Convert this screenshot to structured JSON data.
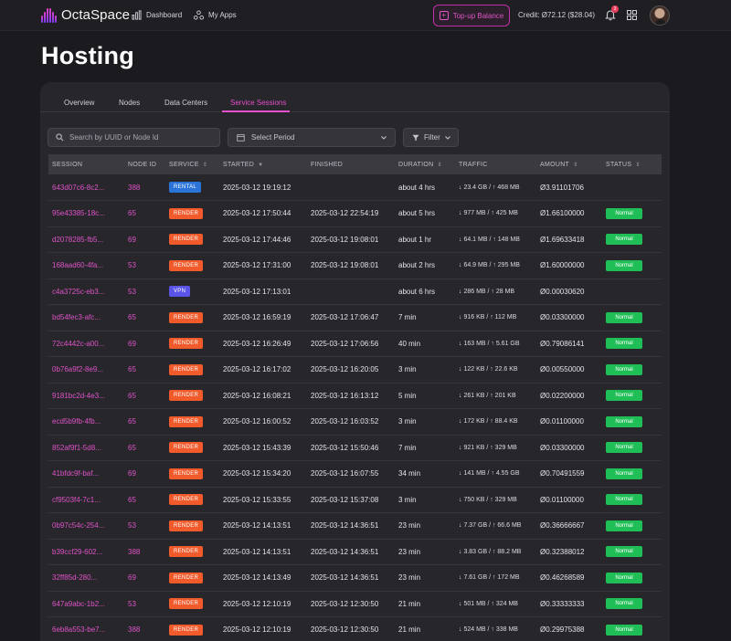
{
  "brand": {
    "name": "OctaSpace"
  },
  "nav": {
    "dashboard": "Dashboard",
    "apps": "My Apps"
  },
  "header": {
    "topup_label": "Top-up Balance",
    "credit": "Credit: Ø72.12 ($28.04)",
    "notifications_count": "3"
  },
  "page": {
    "title": "Hosting"
  },
  "tabs": [
    "Overview",
    "Nodes",
    "Data Centers",
    "Service Sessions"
  ],
  "active_tab": "Service Sessions",
  "filters": {
    "search_placeholder": "Search by UUID or Node Id",
    "period_label": "Select Period",
    "filter_label": "Filter"
  },
  "table": {
    "columns": [
      "SESSION",
      "NODE ID",
      "SERVICE",
      "STARTED",
      "FINISHED",
      "DURATION",
      "TRAFFIC",
      "AMOUNT",
      "STATUS"
    ],
    "rows": [
      {
        "session": "643d07c6-8c2...",
        "node": "388",
        "service": "RENTAL",
        "started": "2025-03-12 19:19:12",
        "finished": "",
        "duration": "about 4 hrs",
        "traffic": "↓ 23.4 GB / ↑ 468 MB",
        "amount": "Ø3.91101706",
        "status": ""
      },
      {
        "session": "95e43385-18c...",
        "node": "65",
        "service": "RENDER",
        "started": "2025-03-12 17:50:44",
        "finished": "2025-03-12 22:54:19",
        "duration": "about 5 hrs",
        "traffic": "↓ 977 MB / ↑ 425 MB",
        "amount": "Ø1.66100000",
        "status": "Normal"
      },
      {
        "session": "d2078285-fb5...",
        "node": "69",
        "service": "RENDER",
        "started": "2025-03-12 17:44:46",
        "finished": "2025-03-12 19:08:01",
        "duration": "about 1 hr",
        "traffic": "↓ 64.1 MB / ↑ 148 MB",
        "amount": "Ø1.69633418",
        "status": "Normal"
      },
      {
        "session": "168aad60-4fa...",
        "node": "53",
        "service": "RENDER",
        "started": "2025-03-12 17:31:00",
        "finished": "2025-03-12 19:08:01",
        "duration": "about 2 hrs",
        "traffic": "↓ 64.9 MB / ↑ 295 MB",
        "amount": "Ø1.60000000",
        "status": "Normal"
      },
      {
        "session": "c4a3725c-eb3...",
        "node": "53",
        "service": "VPN",
        "started": "2025-03-12 17:13:01",
        "finished": "",
        "duration": "about 6 hrs",
        "traffic": "↓ 286 MB / ↑ 28 MB",
        "amount": "Ø0.00030620",
        "status": ""
      },
      {
        "session": "bd54fec3-afc...",
        "node": "65",
        "service": "RENDER",
        "started": "2025-03-12 16:59:19",
        "finished": "2025-03-12 17:06:47",
        "duration": "7 min",
        "traffic": "↓ 916 KB / ↑ 112 MB",
        "amount": "Ø0.03300000",
        "status": "Normal"
      },
      {
        "session": "72c4442c-a00...",
        "node": "69",
        "service": "RENDER",
        "started": "2025-03-12 16:26:49",
        "finished": "2025-03-12 17:06:56",
        "duration": "40 min",
        "traffic": "↓ 163 MB / ↑ 5.61 GB",
        "amount": "Ø0.79086141",
        "status": "Normal"
      },
      {
        "session": "0b76a9f2-8e9...",
        "node": "65",
        "service": "RENDER",
        "started": "2025-03-12 16:17:02",
        "finished": "2025-03-12 16:20:05",
        "duration": "3 min",
        "traffic": "↓ 122 KB / ↑ 22.6 KB",
        "amount": "Ø0.00550000",
        "status": "Normal"
      },
      {
        "session": "9181bc2d-4e3...",
        "node": "65",
        "service": "RENDER",
        "started": "2025-03-12 16:08:21",
        "finished": "2025-03-12 16:13:12",
        "duration": "5 min",
        "traffic": "↓ 261 KB / ↑ 201 KB",
        "amount": "Ø0.02200000",
        "status": "Normal"
      },
      {
        "session": "ecd5b9fb-4fb...",
        "node": "65",
        "service": "RENDER",
        "started": "2025-03-12 16:00:52",
        "finished": "2025-03-12 16:03:52",
        "duration": "3 min",
        "traffic": "↓ 172 KB / ↑ 88.4 KB",
        "amount": "Ø0.01100000",
        "status": "Normal"
      },
      {
        "session": "852af9f1-5d8...",
        "node": "65",
        "service": "RENDER",
        "started": "2025-03-12 15:43:39",
        "finished": "2025-03-12 15:50:46",
        "duration": "7 min",
        "traffic": "↓ 921 KB / ↑ 329 MB",
        "amount": "Ø0.03300000",
        "status": "Normal"
      },
      {
        "session": "41bfdc9f-baf...",
        "node": "69",
        "service": "RENDER",
        "started": "2025-03-12 15:34:20",
        "finished": "2025-03-12 16:07:55",
        "duration": "34 min",
        "traffic": "↓ 141 MB / ↑ 4.55 GB",
        "amount": "Ø0.70491559",
        "status": "Normal"
      },
      {
        "session": "cf9503f4-7c1...",
        "node": "65",
        "service": "RENDER",
        "started": "2025-03-12 15:33:55",
        "finished": "2025-03-12 15:37:08",
        "duration": "3 min",
        "traffic": "↓ 750 KB / ↑ 329 MB",
        "amount": "Ø0.01100000",
        "status": "Normal"
      },
      {
        "session": "0b97c54c-254...",
        "node": "53",
        "service": "RENDER",
        "started": "2025-03-12 14:13:51",
        "finished": "2025-03-12 14:36:51",
        "duration": "23 min",
        "traffic": "↓ 7.37 GB / ↑ 66.6 MB",
        "amount": "Ø0.36666667",
        "status": "Normal"
      },
      {
        "session": "b39ccf29-602...",
        "node": "388",
        "service": "RENDER",
        "started": "2025-03-12 14:13:51",
        "finished": "2025-03-12 14:36:51",
        "duration": "23 min",
        "traffic": "↓ 3.83 GB / ↑ 88.2 MB",
        "amount": "Ø0.32388012",
        "status": "Normal"
      },
      {
        "session": "32ff85d-280...",
        "node": "69",
        "service": "RENDER",
        "started": "2025-03-12 14:13:49",
        "finished": "2025-03-12 14:36:51",
        "duration": "23 min",
        "traffic": "↓ 7.61 GB / ↑ 172 MB",
        "amount": "Ø0.46268589",
        "status": "Normal"
      },
      {
        "session": "647a9abc-1b2...",
        "node": "53",
        "service": "RENDER",
        "started": "2025-03-12 12:10:19",
        "finished": "2025-03-12 12:30:50",
        "duration": "21 min",
        "traffic": "↓ 501 MB / ↑ 324 MB",
        "amount": "Ø0.33333333",
        "status": "Normal"
      },
      {
        "session": "6eb8a553-be7...",
        "node": "388",
        "service": "RENDER",
        "started": "2025-03-12 12:10:19",
        "finished": "2025-03-12 12:30:50",
        "duration": "21 min",
        "traffic": "↓ 524 MB / ↑ 338 MB",
        "amount": "Ø0.29975388",
        "status": "Normal"
      }
    ]
  },
  "colors": {
    "accent": "#e054c6",
    "render": "#f15a2a",
    "rental": "#2a73d8",
    "vpn": "#5a54e8",
    "normal": "#1fbe57"
  }
}
